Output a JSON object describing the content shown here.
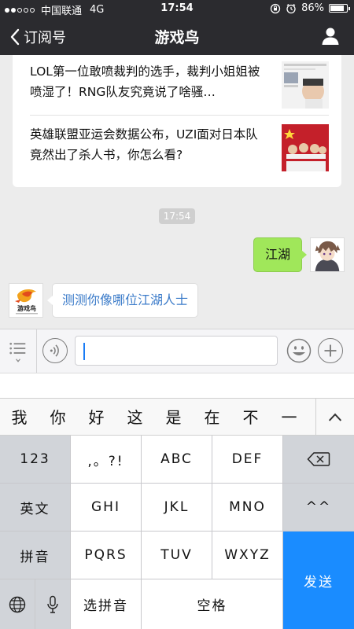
{
  "status": {
    "carrier": "中国联通",
    "network": "4G",
    "time": "17:54",
    "battery": "86%",
    "battery_level": 0.86
  },
  "nav": {
    "back_label": "订阅号",
    "title": "游戏鸟"
  },
  "news": [
    {
      "text": "LOL第一位敢喷裁判的选手，裁判小姐姐被喷湿了！RNG队友究竟说了啥骚…"
    },
    {
      "text": "英雄联盟亚运会数据公布，UZI面对日本队竟然出了杀人书，你怎么看?"
    }
  ],
  "chat": {
    "timestamp": "17:54",
    "outgoing": "江湖",
    "incoming": "测测你像哪位江湖人士",
    "bot_logo_text": "游戏鸟"
  },
  "keyboard": {
    "candidates": [
      "我",
      "你",
      "好",
      "这",
      "是",
      "在",
      "不",
      "一"
    ],
    "rows": [
      [
        "123",
        ",。?!",
        "ABC",
        "DEF",
        "⌫"
      ],
      [
        "英文",
        "GHI",
        "JKL",
        "MNO",
        "^^"
      ],
      [
        "拼音",
        "PQRS",
        "TUV",
        "WXYZ"
      ]
    ],
    "bottom": {
      "pinyin": "选拼音",
      "space": "空格"
    },
    "send": "发送"
  },
  "colors": {
    "navbar": "#2b2b2f",
    "bubble_out": "#a0e75a",
    "link_text": "#3b7bc9",
    "send_key": "#1a8cff"
  }
}
